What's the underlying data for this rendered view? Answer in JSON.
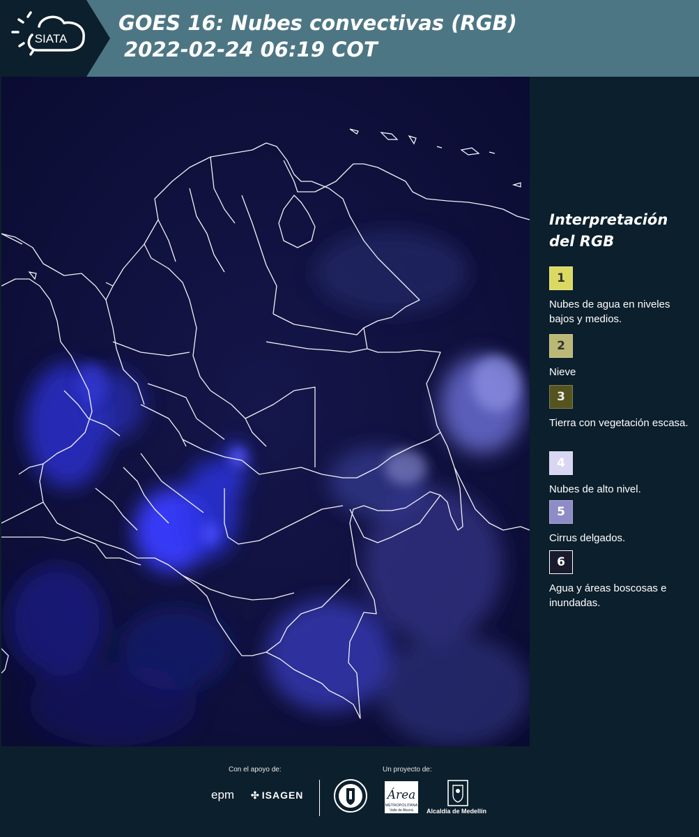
{
  "header": {
    "logo_text": "SIATA",
    "title_line1": "GOES 16: Nubes convectivas (RGB)",
    "title_line2": "2022-02-24 06:19 COT",
    "bar_color": "#4d7684"
  },
  "legend": {
    "title_line1": "Interpretación",
    "title_line2": "del RGB",
    "items": [
      {
        "num": "1",
        "label": "Nubes de agua en niveles bajos y medios.",
        "color": "#dcd963"
      },
      {
        "num": "2",
        "label": "Nieve",
        "color": "#bbb875"
      },
      {
        "num": "3",
        "label": "Tierra con vegetación escasa.",
        "color": "#55541e"
      },
      {
        "num": "4",
        "label": "Nubes de alto nivel.",
        "color": "#d8d6f2"
      },
      {
        "num": "5",
        "label": "Cirrus delgados.",
        "color": "#8e8cc6"
      },
      {
        "num": "6",
        "label": "Agua y áreas boscosas e inundadas.",
        "color": "#1a1a2e"
      }
    ]
  },
  "footer": {
    "support_caption": "Con el apoyo de:",
    "project_caption": "Un proyecto de:",
    "epm_logo": "epm",
    "isagen_logo": "ISAGEN",
    "area_logo": "Área",
    "area_sub": "METROPOLITANA",
    "area_sub2": "Valle de Aburrá",
    "alcaldia": "Alcaldía de Medellín"
  }
}
